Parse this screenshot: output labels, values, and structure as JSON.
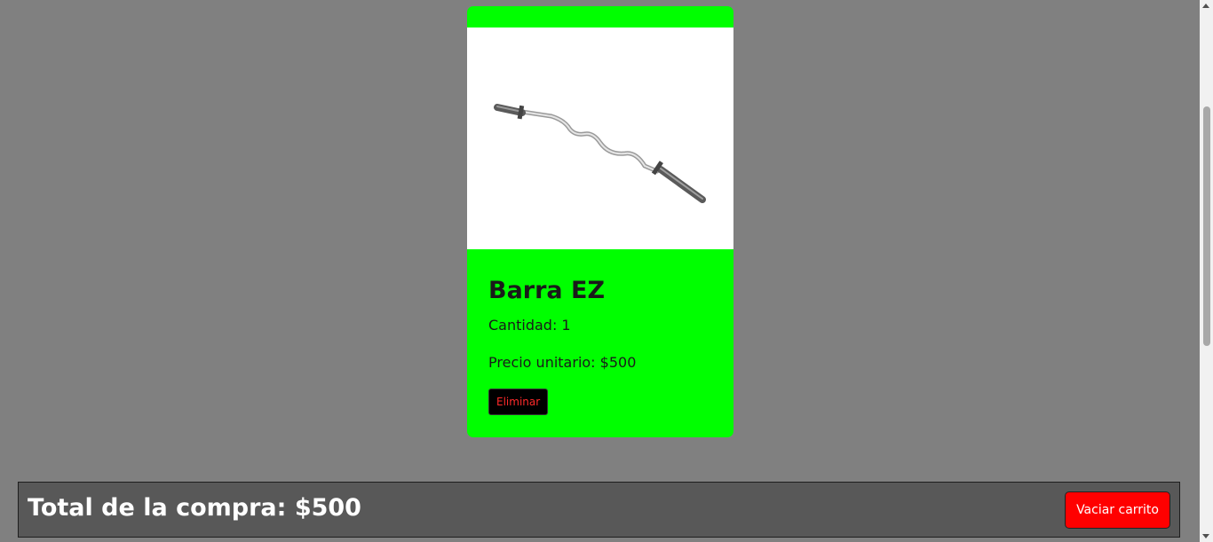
{
  "cart_item": {
    "image_name": "ez-curl-bar",
    "title": "Barra EZ",
    "quantity_text": "Cantidad: 1",
    "price_text": "Precio unitario: $500",
    "remove_label": "Eliminar"
  },
  "cart_summary": {
    "total_text": "Total de la compra: $500",
    "empty_label": "Vaciar carrito"
  },
  "colors": {
    "page_background": "#808080",
    "card_background": "#00ff00",
    "total_bar_background": "#585858",
    "empty_button": "#ff0000",
    "remove_button": "#000000",
    "remove_button_text": "#ff2a2a"
  }
}
